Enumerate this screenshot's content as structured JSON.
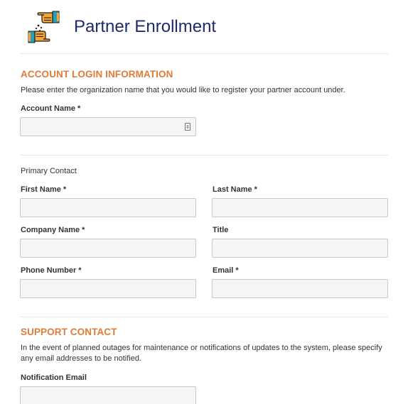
{
  "header": {
    "title": "Partner Enrollment",
    "logo_icon": "pointing-hands-logo-icon"
  },
  "colors": {
    "title": "#1f2a6b",
    "section_heading": "#e07b39",
    "field_bg": "#f5f5f5",
    "field_border": "#c9c9c9"
  },
  "account": {
    "heading": "ACCOUNT LOGIN INFORMATION",
    "description": "Please enter the organization name that you would like to register your partner account under.",
    "account_name": {
      "label": "Account Name",
      "required": "*",
      "value": "",
      "placeholder": ""
    }
  },
  "primary_contact": {
    "heading": "Primary Contact",
    "first_name": {
      "label": "First Name",
      "required": "*",
      "value": ""
    },
    "last_name": {
      "label": "Last Name",
      "required": "*",
      "value": ""
    },
    "company_name": {
      "label": "Company Name",
      "required": "*",
      "value": ""
    },
    "title": {
      "label": "Title",
      "value": ""
    },
    "phone_number": {
      "label": "Phone Number",
      "required": "*",
      "value": ""
    },
    "email": {
      "label": "Email",
      "required": "*",
      "value": ""
    }
  },
  "support": {
    "heading": "SUPPORT CONTACT",
    "description": "In the event of planned outages for maintenance or notifications of updates to the system, please specify any email addresses to be notified.",
    "notification_email": {
      "label": "Notification Email",
      "value": ""
    }
  }
}
